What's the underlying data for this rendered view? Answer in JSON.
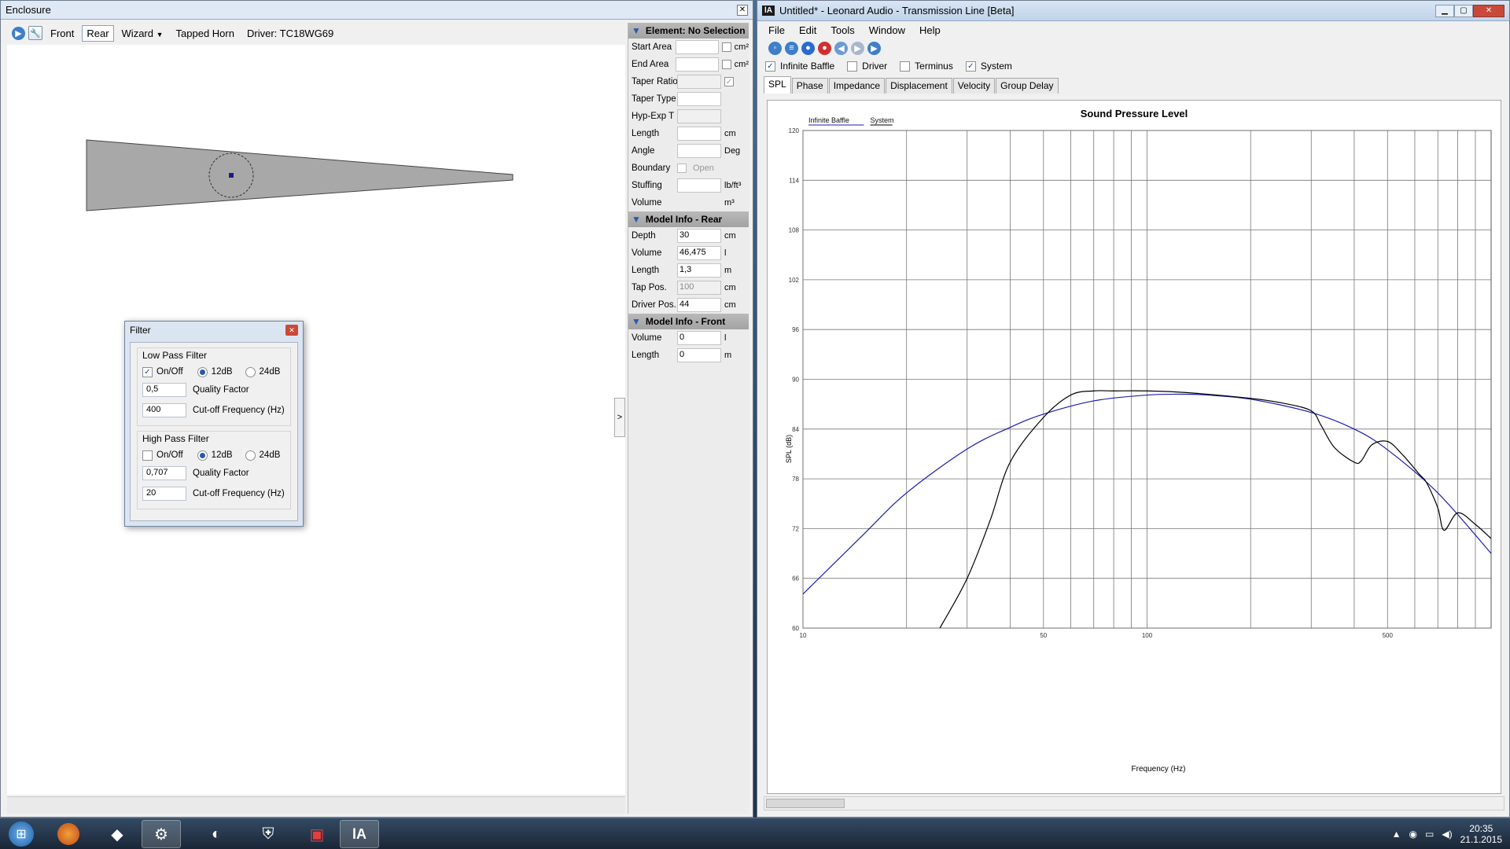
{
  "left_window": {
    "title": "Enclosure",
    "toolbar": {
      "front_label": "Front",
      "rear_label": "Rear",
      "wizard_label": "Wizard",
      "tapped_horn_label": "Tapped Horn",
      "driver_label": "Driver: TC18WG69"
    },
    "collapse_arrow": ">"
  },
  "filter_dialog": {
    "title": "Filter",
    "low_pass": {
      "group_label": "Low Pass Filter",
      "onoff_label": "On/Off",
      "on": true,
      "opt_12_label": "12dB",
      "opt_24_label": "24dB",
      "selected": "12dB",
      "q_value": "0,5",
      "q_label": "Quality Factor",
      "cutoff_value": "400",
      "cutoff_label": "Cut-off Frequency (Hz)"
    },
    "high_pass": {
      "group_label": "High Pass Filter",
      "onoff_label": "On/Off",
      "on": false,
      "opt_12_label": "12dB",
      "opt_24_label": "24dB",
      "selected": "12dB",
      "q_value": "0,707",
      "q_label": "Quality Factor",
      "cutoff_value": "20",
      "cutoff_label": "Cut-off Frequency (Hz)"
    }
  },
  "properties": {
    "element_header": "Element: No Selection",
    "element_rows": [
      {
        "label": "Start Area",
        "value": "",
        "unit": "cm²",
        "check": "empty"
      },
      {
        "label": "End Area",
        "value": "",
        "unit": "cm²",
        "check": "empty"
      },
      {
        "label": "Taper Ratio",
        "value": "",
        "unit": "",
        "check": "checked",
        "disabled": true
      },
      {
        "label": "Taper Type",
        "value": "",
        "unit": "",
        "dropdown": true
      },
      {
        "label": "Hyp-Exp T",
        "value": "",
        "unit": "",
        "disabled": true
      },
      {
        "label": "Length",
        "value": "",
        "unit": "cm"
      },
      {
        "label": "Angle",
        "value": "",
        "unit": "Deg"
      },
      {
        "label": "Boundary",
        "value": "",
        "unit": "",
        "boundary_option": "Open"
      },
      {
        "label": "Stuffing",
        "value": "",
        "unit": "lb/ft³"
      },
      {
        "label": "Volume",
        "value": "",
        "unit": "m³",
        "no_input": true
      }
    ],
    "rear_header": "Model Info - Rear",
    "rear_rows": [
      {
        "label": "Depth",
        "value": "30",
        "unit": "cm"
      },
      {
        "label": "Volume",
        "value": "46,475",
        "unit": "l"
      },
      {
        "label": "Length",
        "value": "1,3",
        "unit": "m"
      },
      {
        "label": "Tap Pos.",
        "value": "100",
        "unit": "cm",
        "disabled": true
      },
      {
        "label": "Driver Pos.",
        "value": "44",
        "unit": "cm"
      }
    ],
    "front_header": "Model Info - Front",
    "front_rows": [
      {
        "label": "Volume",
        "value": "0",
        "unit": "l"
      },
      {
        "label": "Length",
        "value": "0",
        "unit": "m"
      }
    ]
  },
  "right_window": {
    "title": "Untitled* - Leonard Audio - Transmission Line [Beta]",
    "app_icon_text": "lA",
    "menu": [
      "File",
      "Edit",
      "Tools",
      "Window",
      "Help"
    ],
    "checks": [
      {
        "label": "Infinite Baffle",
        "checked": true
      },
      {
        "label": "Driver",
        "checked": false
      },
      {
        "label": "Terminus",
        "checked": false
      },
      {
        "label": "System",
        "checked": true
      }
    ],
    "tabs": [
      "SPL",
      "Phase",
      "Impedance",
      "Displacement",
      "Velocity",
      "Group Delay"
    ],
    "active_tab": "SPL",
    "legend_items": [
      "Infinite Baffle",
      "System"
    ]
  },
  "chart_data": {
    "type": "line",
    "title": "Sound Pressure Level",
    "xlabel": "Frequency (Hz)",
    "ylabel": "SPL (dB)",
    "xscale": "log",
    "xlim": [
      10,
      1000
    ],
    "ylim": [
      60,
      120
    ],
    "yticks": [
      60,
      66,
      72,
      78,
      84,
      90,
      96,
      102,
      108,
      114,
      120
    ],
    "xticks_labeled": [
      10,
      50,
      100,
      500
    ],
    "grid": true,
    "legend_placement": "top-left",
    "series": [
      {
        "name": "Infinite Baffle",
        "color": "#1c1cb0",
        "x": [
          10,
          15,
          20,
          30,
          40,
          50,
          70,
          100,
          130,
          150,
          200,
          300,
          400,
          500,
          700,
          1000
        ],
        "y": [
          64.1,
          71.3,
          76.3,
          81.6,
          84.2,
          85.8,
          87.4,
          88.1,
          88.2,
          88.1,
          87.6,
          86,
          84,
          81.5,
          76.3,
          69
        ]
      },
      {
        "name": "System",
        "color": "#000000",
        "x": [
          25,
          30,
          35,
          40,
          50,
          60,
          70,
          80,
          100,
          130,
          200,
          250,
          300,
          320,
          350,
          400,
          420,
          450,
          500,
          550,
          620,
          650,
          700,
          730,
          800,
          900,
          1000
        ],
        "y": [
          60,
          66,
          73,
          80,
          85.4,
          88.1,
          88.6,
          88.6,
          88.6,
          88.4,
          87.7,
          87.1,
          86.2,
          84.5,
          81.8,
          80,
          80.2,
          82.1,
          82.5,
          81,
          78.5,
          77.5,
          74.5,
          71.8,
          73.9,
          72.5,
          70.8
        ]
      }
    ]
  },
  "taskbar": {
    "clock_time": "20:35",
    "clock_date": "21.1.2015"
  }
}
